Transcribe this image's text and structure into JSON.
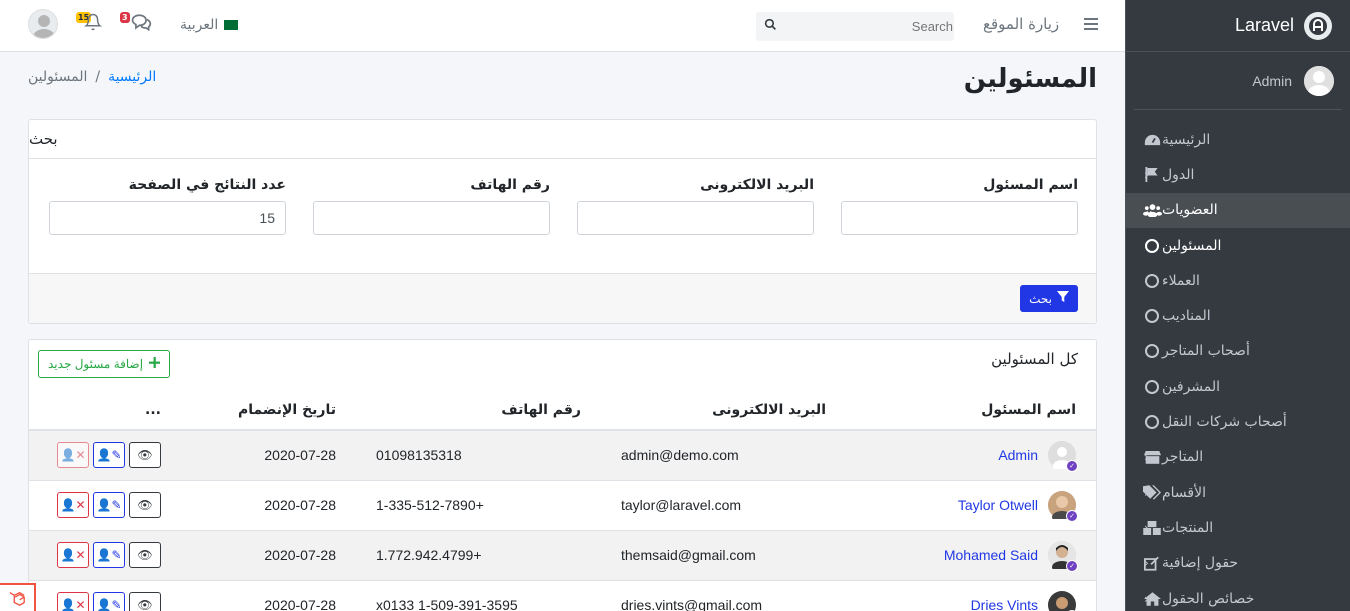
{
  "app": {
    "brand": "Laravel",
    "user": "Admin"
  },
  "topnav": {
    "search_placeholder": "Search",
    "visit_site": "زيارة الموقع",
    "language": "العربية",
    "notifications_count": "15",
    "messages_count": "3"
  },
  "sidebar": {
    "items": [
      {
        "label": "الرئيسية",
        "icon": "dashboard-icon"
      },
      {
        "label": "الدول",
        "icon": "flag-icon"
      },
      {
        "label": "العضويات",
        "icon": "users-icon"
      },
      {
        "label": "المسئولين",
        "icon": "circle-icon"
      },
      {
        "label": "العملاء",
        "icon": "circle-icon"
      },
      {
        "label": "المناديب",
        "icon": "circle-icon"
      },
      {
        "label": "أصحاب المتاجر",
        "icon": "circle-icon"
      },
      {
        "label": "المشرفين",
        "icon": "circle-icon"
      },
      {
        "label": "أصحاب شركات النقل",
        "icon": "circle-icon"
      },
      {
        "label": "المتاجر",
        "icon": "store-icon"
      },
      {
        "label": "الأقسام",
        "icon": "tags-icon"
      },
      {
        "label": "المنتجات",
        "icon": "boxes-icon"
      },
      {
        "label": "حقول إضافية",
        "icon": "edit-icon"
      },
      {
        "label": "خصائص الحقول",
        "icon": "home-icon"
      }
    ]
  },
  "page": {
    "title": "المسئولين",
    "breadcrumb_home": "الرئيسية",
    "breadcrumb_sep": "/",
    "breadcrumb_current": "المسئولين"
  },
  "search": {
    "header": "بحث",
    "fields": [
      {
        "label": "اسم المسئول",
        "value": ""
      },
      {
        "label": "البريد الالكترونى",
        "value": ""
      },
      {
        "label": "رقم الهاتف",
        "value": ""
      },
      {
        "label": "عدد النتائج في الصفحة",
        "value": "15"
      }
    ],
    "button": "بحث"
  },
  "list": {
    "title": "كل المسئولين",
    "add_button": "إضافة مسئول جديد",
    "columns": [
      "اسم المسئول",
      "البريد الالكترونى",
      "رقم الهاتف",
      "تاريخ الإنضمام",
      "..."
    ],
    "rows": [
      {
        "name": "Admin",
        "email": "admin@demo.com",
        "phone": "01098135318",
        "date": "2020-07-28"
      },
      {
        "name": "Taylor Otwell",
        "email": "taylor@laravel.com",
        "phone": "1-335-512-7890+",
        "date": "2020-07-28"
      },
      {
        "name": "Mohamed Said",
        "email": "themsaid@gmail.com",
        "phone": "1.772.942.4799+",
        "date": "2020-07-28"
      },
      {
        "name": "Dries Vints",
        "email": "dries.vints@gmail.com",
        "phone": "x0133 1-509-391-3595",
        "date": "2020-07-28"
      }
    ]
  },
  "colors": {
    "sidebar_bg": "#343a40",
    "primary": "#2137e5",
    "success": "#28a745",
    "danger": "#dc3545"
  }
}
